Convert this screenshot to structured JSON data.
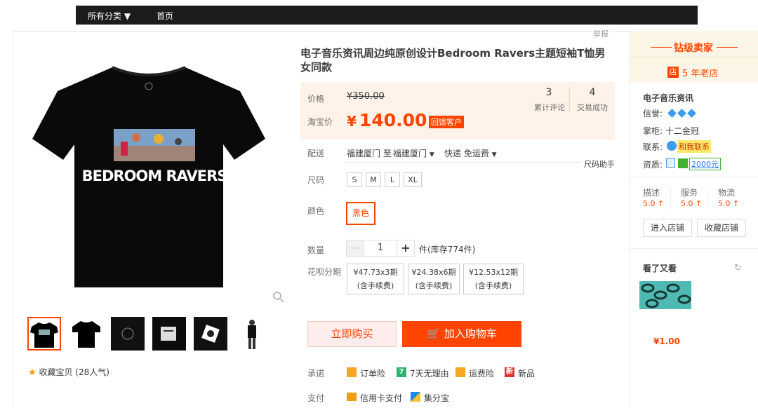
{
  "nav": {
    "categories": "所有分类 ▼",
    "home": "首页"
  },
  "report": "举报",
  "product": {
    "title": "电子音乐资讯周边纯原创设计Bedroom Ravers主题短袖T恤男女同款",
    "image_text": "BEDROOM RAVERS",
    "favorite": "收藏宝贝 (28人气)"
  },
  "price": {
    "label_price": "价格",
    "original": "¥350.00",
    "label_taobao": "淘宝价",
    "yen": "¥",
    "current": "140.00",
    "promo_badge": "回馈客户",
    "reviews_count": "3",
    "reviews_label": "累计评论",
    "sales_count": "4",
    "sales_label": "交易成功"
  },
  "delivery": {
    "label": "配送",
    "from": "福建厦门 至",
    "to": "福建厦门",
    "method": "快递 免运费",
    "size_helper": "尺码助手"
  },
  "size": {
    "label": "尺码",
    "options": [
      "S",
      "M",
      "L",
      "XL"
    ]
  },
  "color": {
    "label": "颜色",
    "selected": "黑色"
  },
  "quantity": {
    "label": "数量",
    "minus": "−",
    "value": "1",
    "plus": "+",
    "stock": "件(库存774件)"
  },
  "installment": {
    "label": "花呗分期",
    "options": [
      {
        "line1": "¥47.73x3期",
        "line2": "(含手续费)"
      },
      {
        "line1": "¥24.38x6期",
        "line2": "(含手续费)"
      },
      {
        "line1": "¥12.53x12期",
        "line2": "(含手续费)"
      }
    ]
  },
  "actions": {
    "buy": "立即购买",
    "cart": "加入购物车"
  },
  "promise": {
    "label": "承诺",
    "items": [
      "订单险",
      "7天无理由",
      "运费险",
      "新品"
    ],
    "seven": "7",
    "new_char": "新"
  },
  "payment": {
    "label": "支付",
    "items": [
      "信用卡支付",
      "集分宝"
    ]
  },
  "seller": {
    "level": "钻级卖家",
    "store_icon": "店",
    "years": "5 年老店",
    "name": "电子音乐资讯",
    "credit": "信誉:",
    "keeper": "掌柜: 十二金冠",
    "contact": "联系:",
    "contact_badge": "和我联系",
    "qualification": "资质:",
    "deposit": "2000元",
    "ratings": [
      {
        "label": "描述",
        "score": "5.0 ↑"
      },
      {
        "label": "服务",
        "score": "5.0 ↑"
      },
      {
        "label": "物流",
        "score": "5.0 ↑"
      }
    ],
    "enter_shop": "进入店铺",
    "fav_shop": "收藏店铺"
  },
  "recommend": {
    "title": "看了又看",
    "price": "¥1.00"
  },
  "colors": {
    "accent": "#ff4400",
    "topbar": "#1c1c1c",
    "price_bg": "#fff2e8",
    "seller_bg": "#fdf6e7"
  }
}
